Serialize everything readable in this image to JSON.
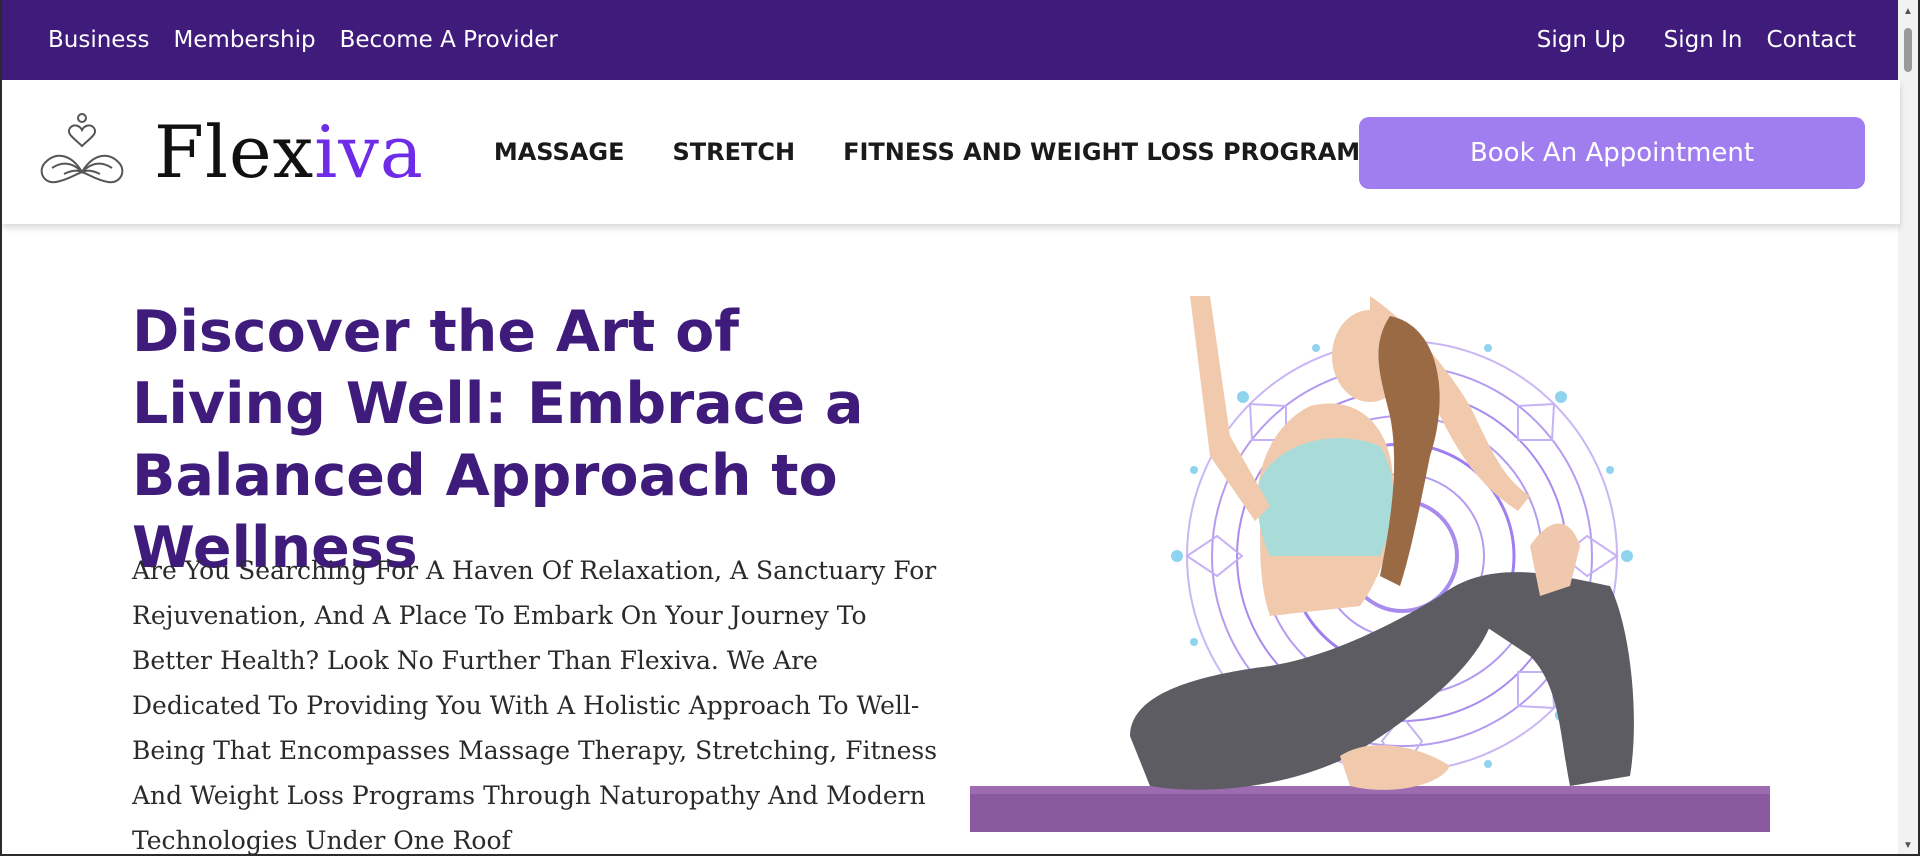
{
  "topbar": {
    "left_links": [
      "Business",
      "Membership",
      "Become A Provider"
    ],
    "sign_up": "Sign Up",
    "sign_in": "Sign In",
    "contact": "Contact"
  },
  "brand": {
    "name_part1": "Flex",
    "name_part2": "iva",
    "accent_color": "#6f2ce8"
  },
  "nav": {
    "items": [
      "MASSAGE",
      "STRETCH",
      "FITNESS AND WEIGHT LOSS PROGRAM"
    ]
  },
  "cta": {
    "book_label": "Book An Appointment"
  },
  "hero": {
    "title": "Discover the Art of Living Well: Embrace a Balanced Approach to Wellness",
    "body": "Are You Searching For A Haven Of Relaxation, A Sanctuary For Rejuvenation, And A Place To Embark On Your Journey To Better Health? Look No Further Than Flexiva. We Are Dedicated To Providing You With A Holistic Approach To Well-Being That Encompasses Massage Therapy, Stretching, Fitness And Weight Loss Programs Through Naturopathy And Modern Technologies Under One Roof",
    "image": "woman-yoga-pose-mandala-image"
  },
  "colors": {
    "topbar": "#3f1b7c",
    "title": "#3f1b7c",
    "button": "#a07ef0"
  }
}
